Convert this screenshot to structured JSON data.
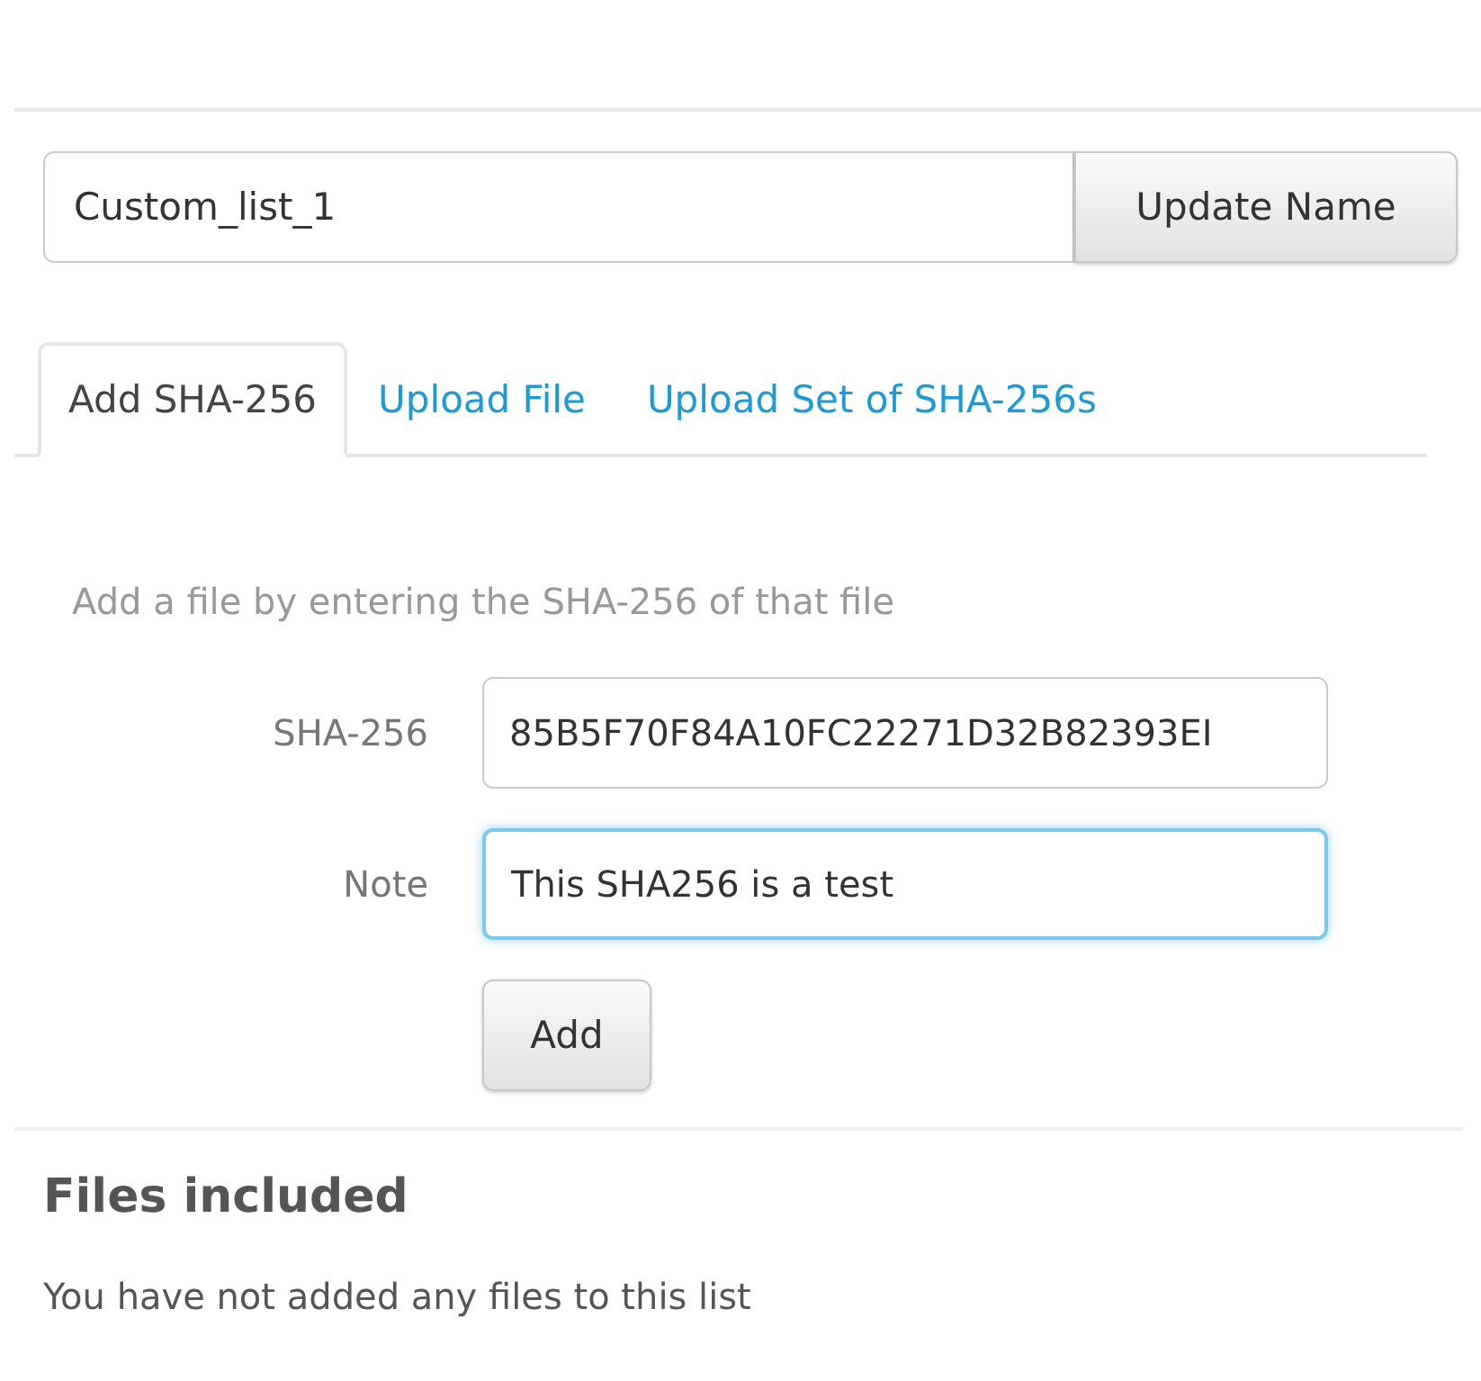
{
  "name_form": {
    "value": "Custom_list_1",
    "button": "Update Name"
  },
  "tabs": [
    {
      "label": "Add SHA-256",
      "selected": true
    },
    {
      "label": "Upload File",
      "selected": false
    },
    {
      "label": "Upload Set of SHA-256s",
      "selected": false
    }
  ],
  "instructions": "Add a file by entering the SHA-256 of that file",
  "fields": [
    {
      "label": "SHA-256",
      "value": "85B5F70F84A10FC22271D32B82393EI",
      "focused": false
    },
    {
      "label": "Note",
      "value": "This SHA256 is a test",
      "focused": true
    }
  ],
  "add_button": "Add",
  "files_section": {
    "title": "Files included",
    "empty_message": "You have not added any files to this list"
  }
}
